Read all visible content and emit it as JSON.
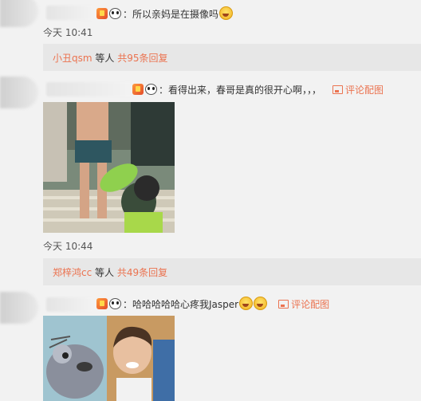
{
  "comments": [
    {
      "text": "：所以亲妈是在摄像吗",
      "time": "今天 10:41",
      "reply": {
        "users": "小丑qsm",
        "mid": " 等人 ",
        "count": "共95条回复"
      }
    },
    {
      "text": "：看得出来，春哥是真的很开心啊，，，",
      "pic_label": "评论配图",
      "time": "今天 10:44",
      "reply": {
        "users": "郑梓鸿cc",
        "mid": " 等人 ",
        "count": "共49条回复"
      }
    },
    {
      "text": "：哈哈哈哈哈心疼我Jasper",
      "pic_label": "评论配图"
    }
  ],
  "icons": [
    "vip-badge-icon",
    "panda-emoji-icon",
    "laugh-cry-emoji-icon",
    "picture-icon"
  ],
  "colors": {
    "link": "#eb7350",
    "background": "#f2f2f2",
    "reply_bg": "#e7e7e7"
  }
}
